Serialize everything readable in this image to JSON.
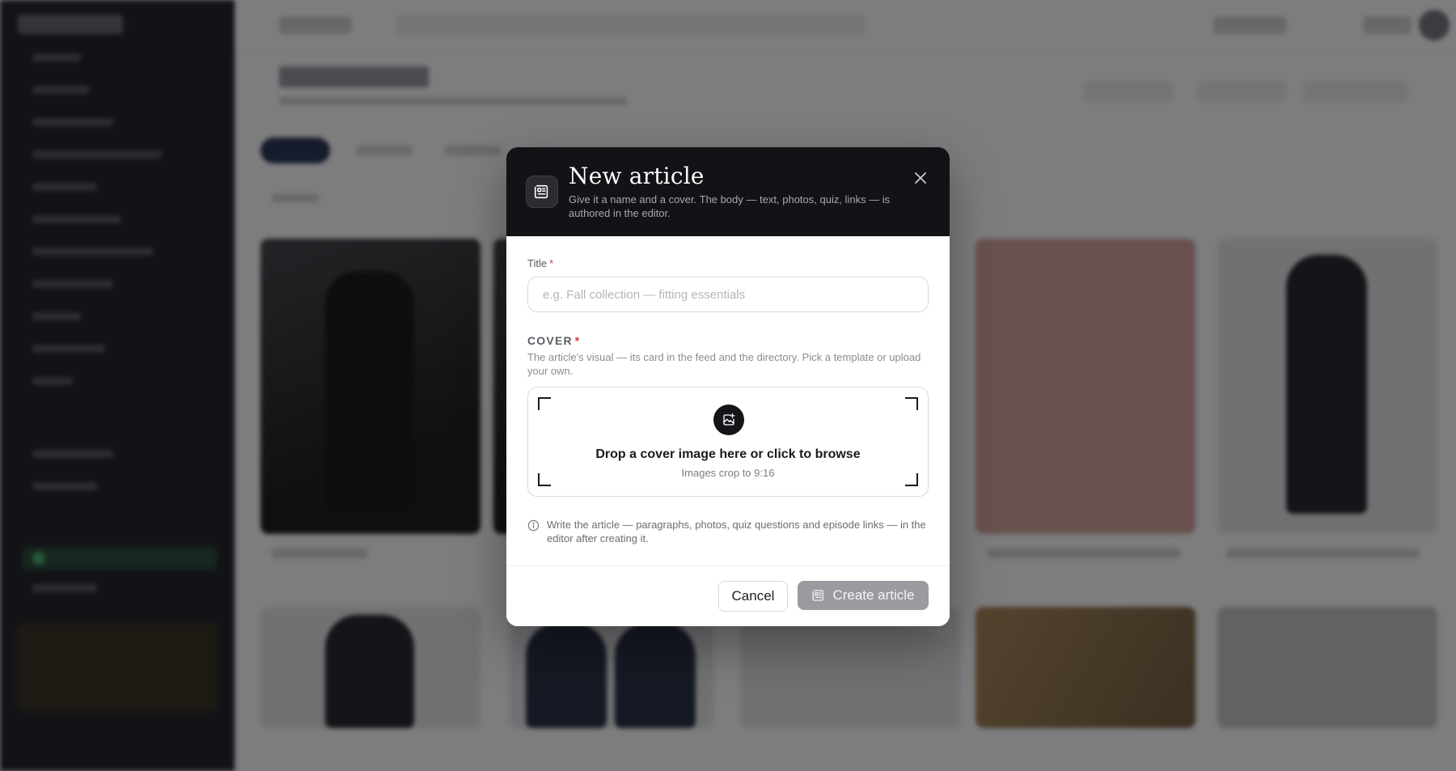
{
  "modal": {
    "title": "New article",
    "subtitle": "Give it a name and a cover. The body — text, photos, quiz, links — is authored in the editor.",
    "header_icon": "newspaper-icon",
    "close_icon": "close-icon"
  },
  "title_field": {
    "label": "Title",
    "required_mark": "*",
    "placeholder": "e.g. Fall collection — fitting essentials",
    "value": ""
  },
  "cover": {
    "label": "COVER",
    "required_mark": "*",
    "help": "The article's visual — its card in the feed and the directory. Pick a template or upload your own.",
    "dropzone_title": "Drop a cover image here or click to browse",
    "dropzone_sub": "Images crop to 9:16",
    "dropzone_icon": "image-add-icon"
  },
  "info": {
    "icon": "info-icon",
    "text": "Write the article — paragraphs, photos, quiz questions and episode links — in the editor after creating it."
  },
  "footer": {
    "cancel_label": "Cancel",
    "create_label": "Create article",
    "create_icon": "newspaper-icon"
  },
  "colors": {
    "header_bg": "#121316",
    "required": "#d63b3b",
    "disabled_button": "#9a9ba0"
  }
}
